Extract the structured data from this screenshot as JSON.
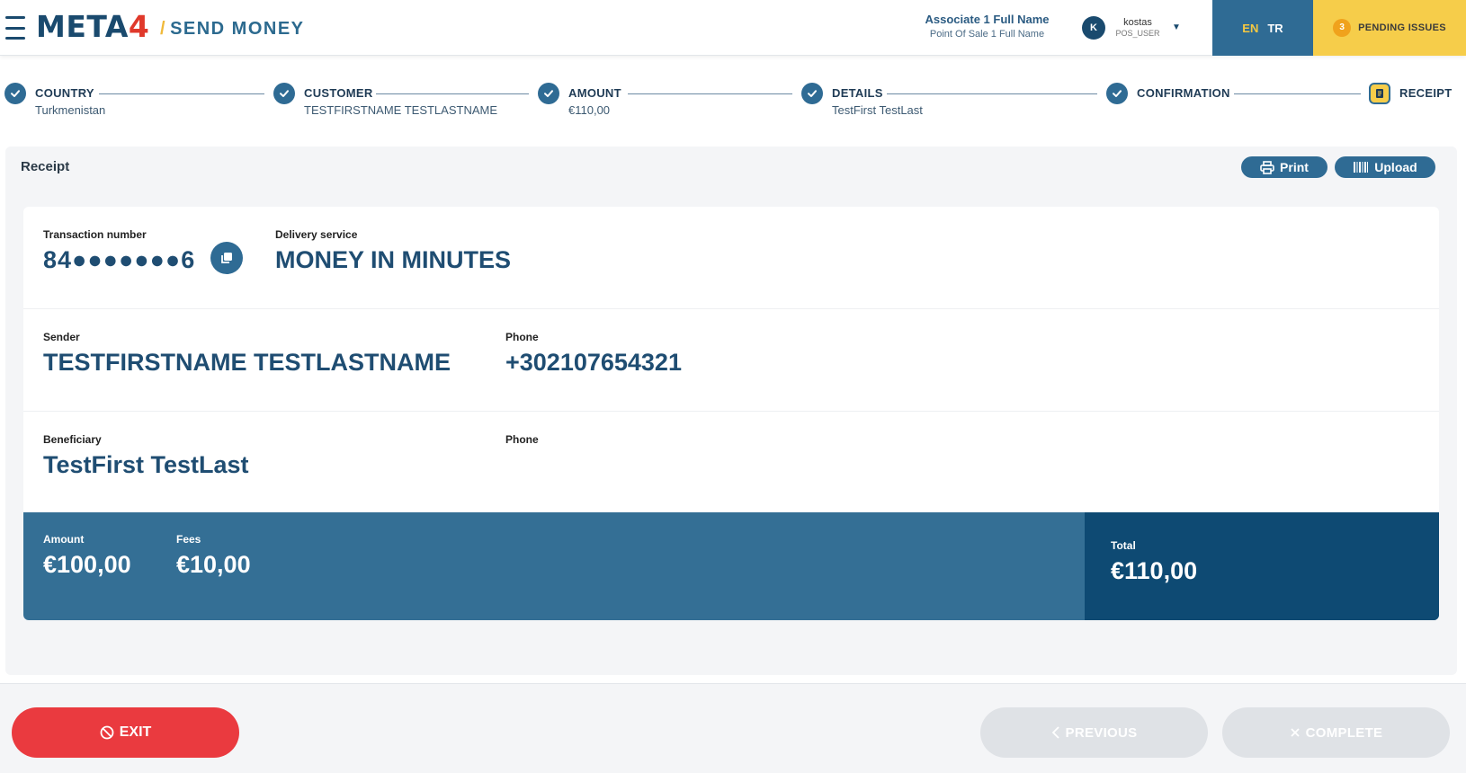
{
  "header": {
    "logo_text": "META",
    "logo_accent": "4",
    "page_title": "SEND MONEY",
    "associate_name": "Associate 1 Full Name",
    "point_of_sale": "Point Of Sale 1 Full Name",
    "user": {
      "initial": "K",
      "name": "kostas",
      "role": "POS_USER"
    },
    "languages": {
      "active": "EN",
      "other": "TR"
    },
    "pending": {
      "count": "3",
      "label": "PENDING ISSUES"
    }
  },
  "steps": [
    {
      "title": "COUNTRY",
      "subtitle": "Turkmenistan"
    },
    {
      "title": "CUSTOMER",
      "subtitle": "TESTFIRSTNAME TESTLASTNAME"
    },
    {
      "title": "AMOUNT",
      "subtitle": "€110,00"
    },
    {
      "title": "DETAILS",
      "subtitle": "TestFirst TestLast"
    },
    {
      "title": "CONFIRMATION",
      "subtitle": ""
    },
    {
      "title": "RECEIPT",
      "subtitle": ""
    }
  ],
  "receipt": {
    "title": "Receipt",
    "print_label": "Print",
    "upload_label": "Upload",
    "transaction_label": "Transaction number",
    "transaction_value": "84●●●●●●●6",
    "delivery_label": "Delivery service",
    "delivery_value": "MONEY IN MINUTES",
    "sender_label": "Sender",
    "sender_value": "TESTFIRSTNAME TESTLASTNAME",
    "sender_phone_label": "Phone",
    "sender_phone_value": "+302107654321",
    "beneficiary_label": "Beneficiary",
    "beneficiary_value": "TestFirst TestLast",
    "beneficiary_phone_label": "Phone",
    "beneficiary_phone_value": "",
    "amount_label": "Amount",
    "amount_value": "€100,00",
    "fees_label": "Fees",
    "fees_value": "€10,00",
    "total_label": "Total",
    "total_value": "€110,00"
  },
  "footer": {
    "exit_label": "EXIT",
    "previous_label": "PREVIOUS",
    "complete_label": "COMPLETE"
  },
  "colors": {
    "brand": "#1a4a6e",
    "accent_blue": "#2f6b94",
    "accent_yellow": "#f6cd4a",
    "danger": "#ea3a3f",
    "total_bar": "#346f95",
    "total_dark": "#0e4a73"
  }
}
